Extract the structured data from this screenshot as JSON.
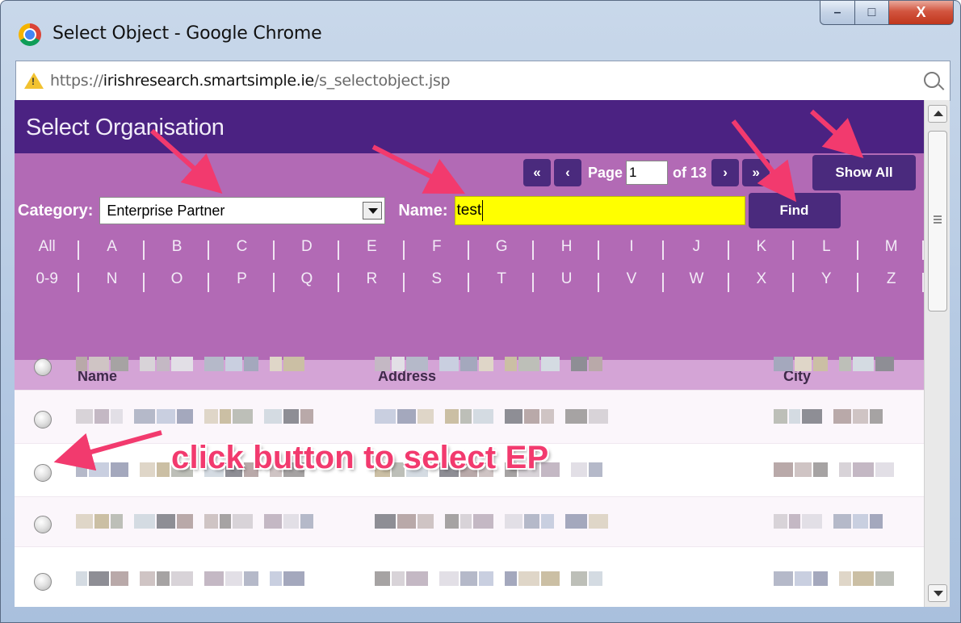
{
  "window": {
    "title": "Select Object - Google Chrome",
    "minimize_glyph": "–",
    "maximize_glyph": "□",
    "close_glyph": "X"
  },
  "address": {
    "scheme": "https://",
    "host": "irishresearch.smartsimple.ie",
    "path": "/s_selectobject.jsp"
  },
  "page": {
    "title": "Select Organisation"
  },
  "pager": {
    "first": "«",
    "prev": "‹",
    "page_label": "Page",
    "page_value": "1",
    "of_label": "of 13",
    "next": "›",
    "last": "»"
  },
  "show_all_label": "Show All",
  "filter": {
    "category_label": "Category:",
    "category_value": "Enterprise Partner",
    "name_label": "Name:",
    "name_value": "test",
    "find_label": "Find"
  },
  "letters_row1": [
    "All",
    "A",
    "B",
    "C",
    "D",
    "E",
    "F",
    "G",
    "H",
    "I",
    "J",
    "K",
    "L",
    "M"
  ],
  "letters_row2": [
    "0-9",
    "N",
    "O",
    "P",
    "Q",
    "R",
    "S",
    "T",
    "U",
    "V",
    "W",
    "X",
    "Y",
    "Z"
  ],
  "table": {
    "headers": {
      "name": "Name",
      "address": "Address",
      "city": "City"
    },
    "rows": [
      {
        "id": "row-1"
      },
      {
        "id": "row-2"
      },
      {
        "id": "row-3"
      },
      {
        "id": "row-4"
      },
      {
        "id": "row-5"
      }
    ]
  },
  "annotation": {
    "text": "click button to select EP",
    "color": "#f23a6e"
  },
  "colors": {
    "header": "#4b2282",
    "panel": "#b26ab5",
    "button": "#4a2a7d",
    "name_highlight": "#ffff00",
    "table_head": "#d4a4d6"
  }
}
